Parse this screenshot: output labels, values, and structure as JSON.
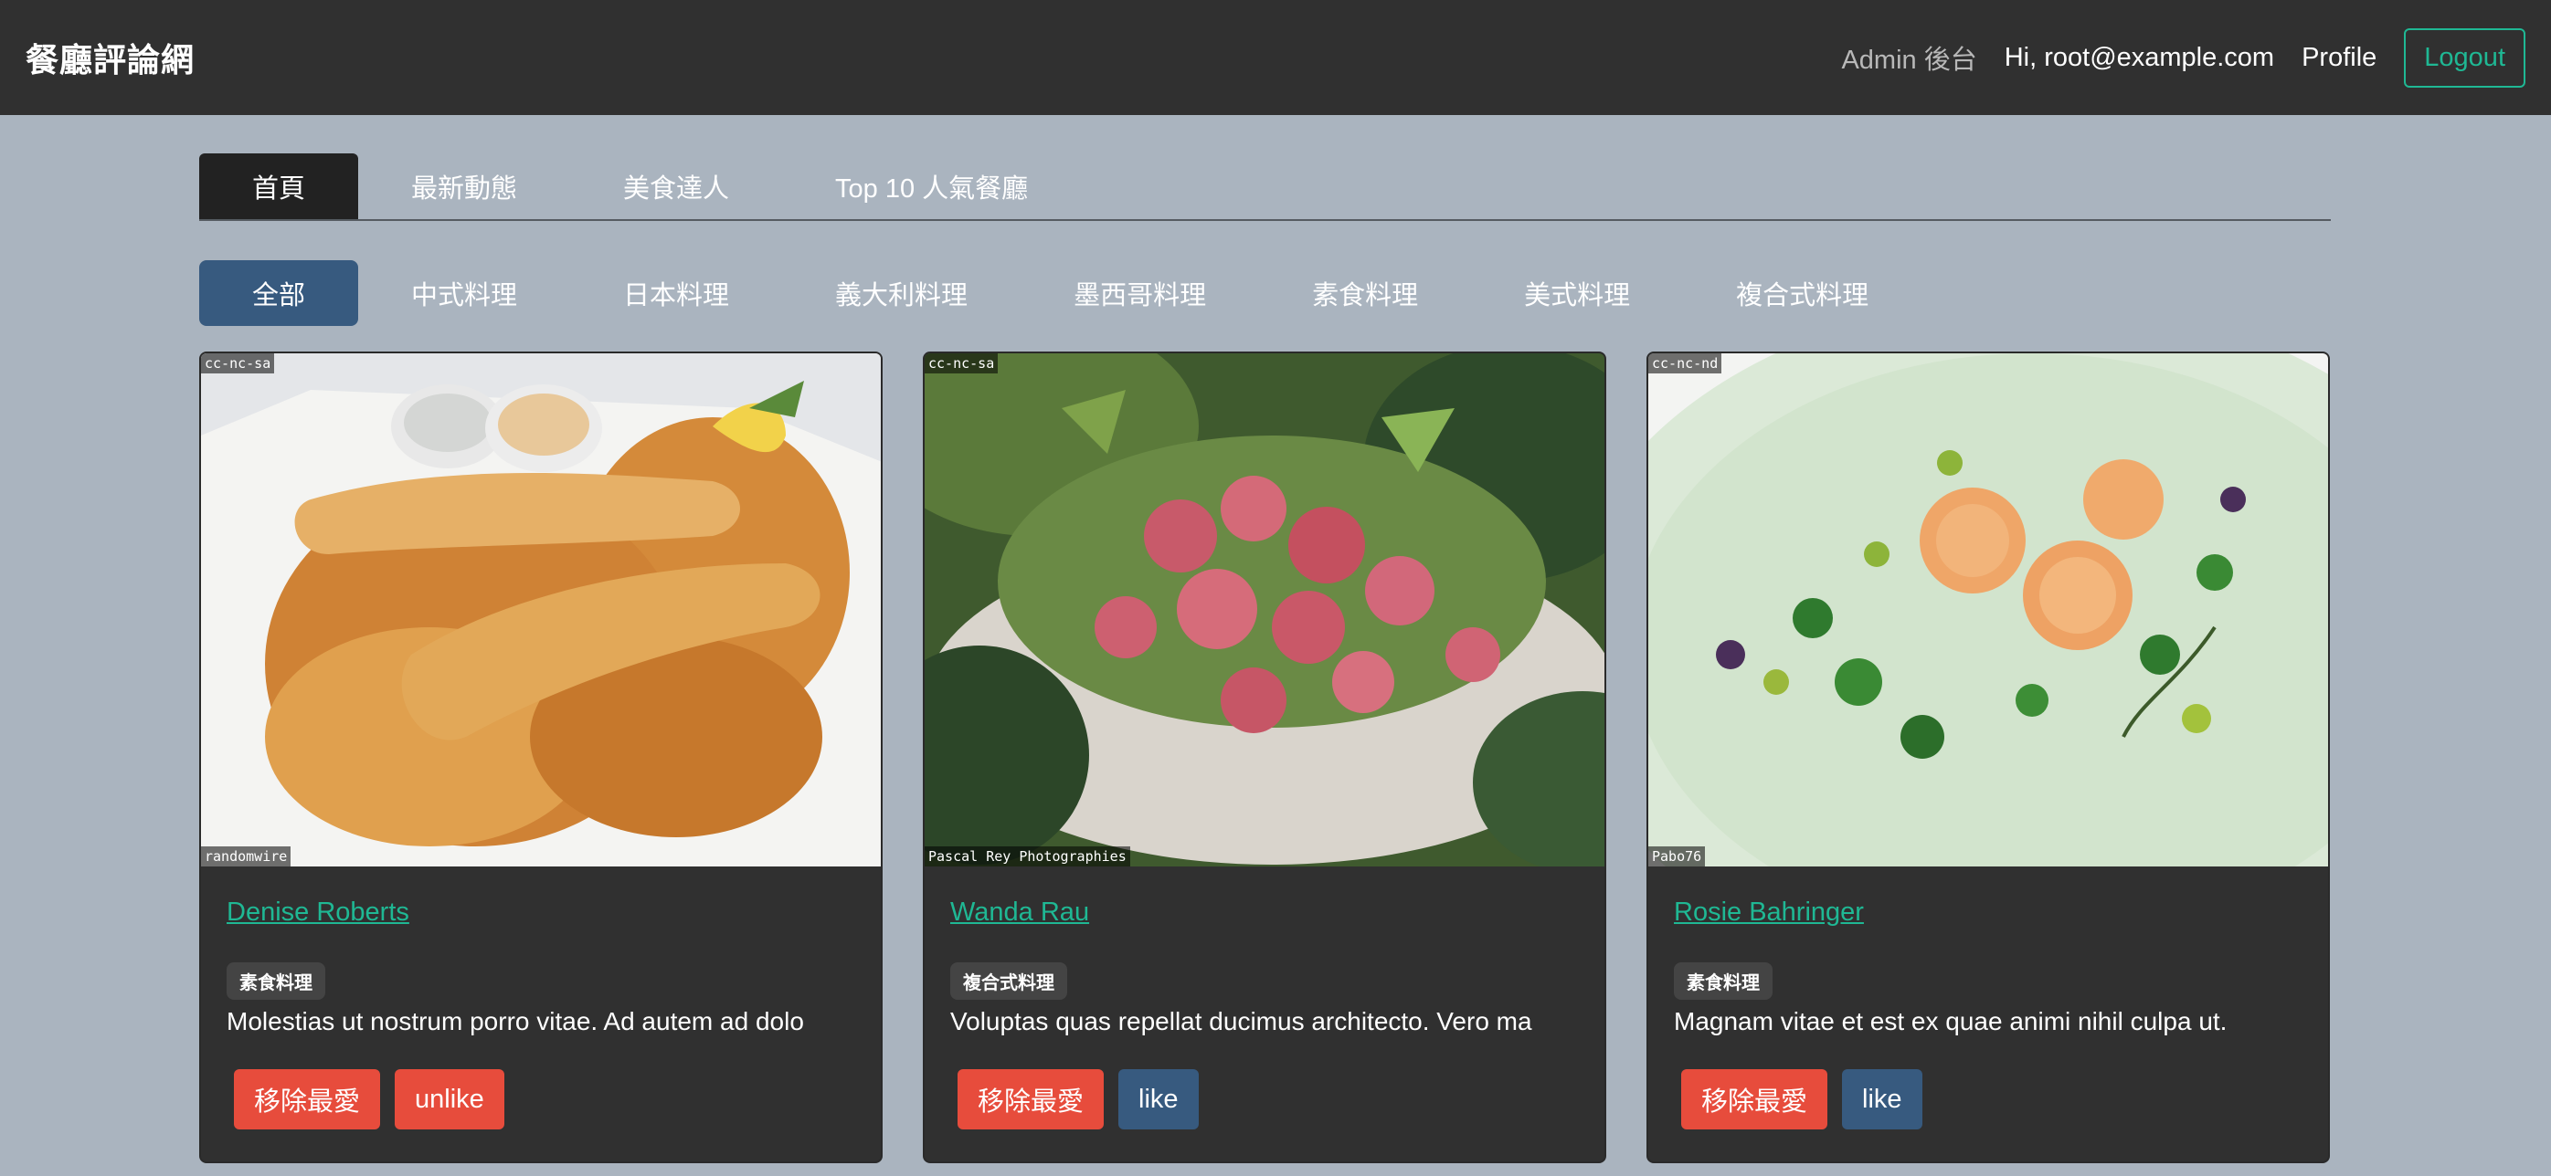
{
  "navbar": {
    "brand": "餐廳評論網",
    "admin_link": "Admin 後台",
    "greeting": "Hi, root@example.com",
    "profile_link": "Profile",
    "logout_label": "Logout"
  },
  "tabs": [
    {
      "label": "首頁",
      "active": true
    },
    {
      "label": "最新動態",
      "active": false
    },
    {
      "label": "美食達人",
      "active": false
    },
    {
      "label": "Top 10 人氣餐廳",
      "active": false
    }
  ],
  "categories": [
    {
      "label": "全部",
      "active": true
    },
    {
      "label": "中式料理",
      "active": false
    },
    {
      "label": "日本料理",
      "active": false
    },
    {
      "label": "義大利料理",
      "active": false
    },
    {
      "label": "墨西哥料理",
      "active": false
    },
    {
      "label": "素食料理",
      "active": false
    },
    {
      "label": "美式料理",
      "active": false
    },
    {
      "label": "複合式料理",
      "active": false
    }
  ],
  "restaurants": [
    {
      "name": "Denise Roberts",
      "category": "素食料理",
      "description": "Molestias ut nostrum porro vitae. Ad autem ad dolo",
      "license": "cc-nc-sa",
      "credit": "randomwire",
      "favorite_button": "移除最愛",
      "like_button": "unlike",
      "liked": true,
      "image_icon": "fish-and-chips-photo"
    },
    {
      "name": "Wanda Rau",
      "category": "複合式料理",
      "description": "Voluptas quas repellat ducimus architecto. Vero ma",
      "license": "cc-nc-sa",
      "credit": "Pascal Rey Photographies",
      "favorite_button": "移除最愛",
      "like_button": "like",
      "liked": false,
      "image_icon": "tuna-salad-photo"
    },
    {
      "name": "Rosie Bahringer",
      "category": "素食料理",
      "description": "Magnam vitae et est ex quae animi nihil culpa ut.",
      "license": "cc-nc-nd",
      "credit": "Pabo76",
      "favorite_button": "移除最愛",
      "like_button": "like",
      "liked": false,
      "image_icon": "melon-soup-photo"
    }
  ],
  "colors": {
    "navbar_bg": "#303030",
    "page_bg": "#aab4bf",
    "accent": "#1fb894",
    "primary": "#375a7f",
    "danger": "#e74c3c"
  }
}
